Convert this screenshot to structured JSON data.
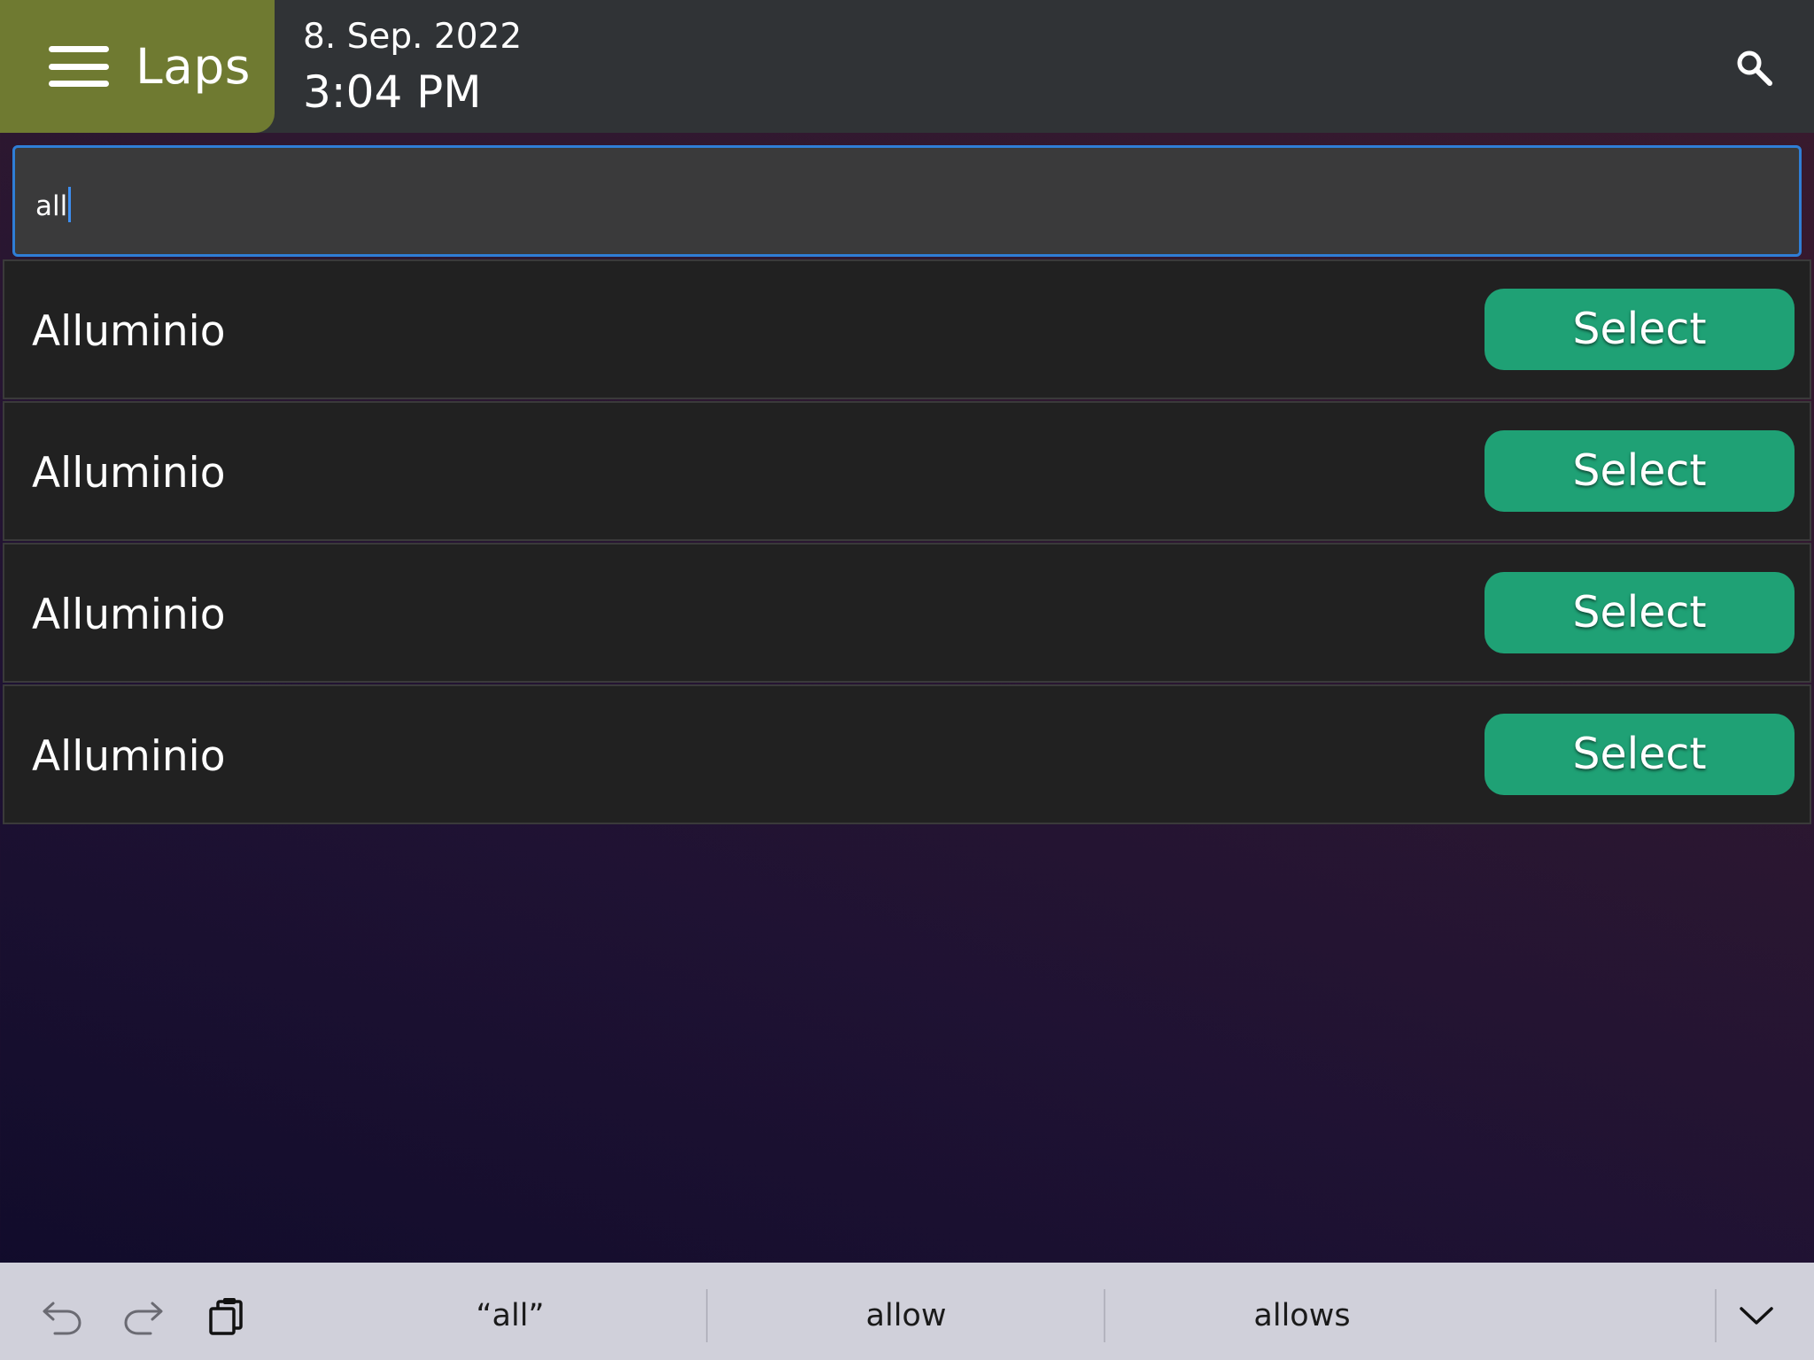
{
  "header": {
    "app_title": "Laps",
    "date": "8. Sep. 2022",
    "time": "3:04 PM",
    "menu_icon": "hamburger-menu-icon",
    "search_icon": "search-icon",
    "brand_color": "#6f7a31"
  },
  "search": {
    "value": "all",
    "focus_color": "#2f7ed6"
  },
  "results": [
    {
      "label": "Alluminio",
      "button": "Select"
    },
    {
      "label": "Alluminio",
      "button": "Select"
    },
    {
      "label": "Alluminio",
      "button": "Select"
    },
    {
      "label": "Alluminio",
      "button": "Select"
    }
  ],
  "accent_color": "#1fa175",
  "keyboard_bar": {
    "icons": [
      "undo-icon",
      "redo-icon",
      "paste-icon",
      "chevron-down-icon"
    ],
    "suggestions": [
      "“all”",
      "allow",
      "allows"
    ]
  }
}
